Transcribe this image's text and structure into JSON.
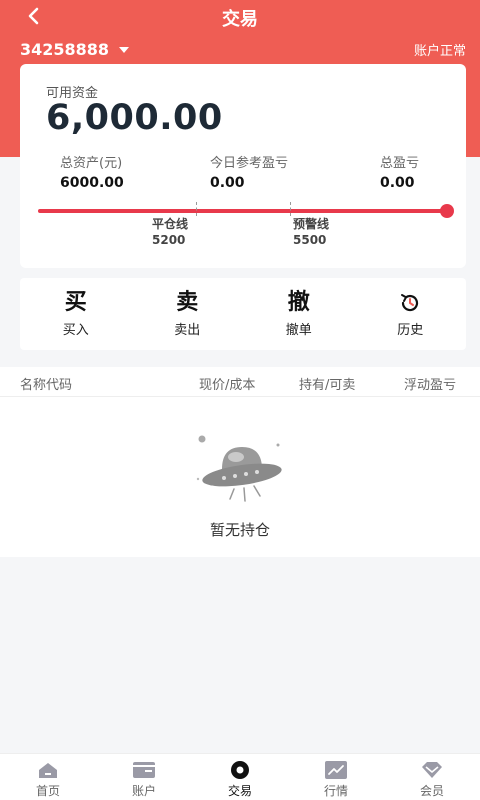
{
  "header": {
    "title": "交易",
    "back_icon": "chevron-left-icon",
    "account_number": "34258888",
    "account_status": "账户正常"
  },
  "funds": {
    "available_label": "可用资金",
    "available_value": "6,000.00",
    "stats": [
      {
        "label": "总资产(元)",
        "value": "6000.00"
      },
      {
        "label": "今日参考盈亏",
        "value": "0.00"
      },
      {
        "label": "总盈亏",
        "value": "0.00"
      }
    ],
    "markers": [
      {
        "label": "平仓线",
        "value": "5200"
      },
      {
        "label": "预警线",
        "value": "5500"
      }
    ]
  },
  "actions": [
    {
      "glyph": "买",
      "label": "买入"
    },
    {
      "glyph": "卖",
      "label": "卖出"
    },
    {
      "glyph": "撤",
      "label": "撤单"
    },
    {
      "icon": "history-icon",
      "label": "历史"
    }
  ],
  "table": {
    "headers": [
      "名称代码",
      "现价/成本",
      "持有/可卖",
      "浮动盈亏"
    ]
  },
  "empty": {
    "text": "暂无持仓",
    "icon": "ufo-icon"
  },
  "tabs": [
    {
      "label": "首页",
      "icon": "home-icon"
    },
    {
      "label": "账户",
      "icon": "wallet-icon"
    },
    {
      "label": "交易",
      "icon": "trade-icon",
      "active": true
    },
    {
      "label": "行情",
      "icon": "chart-icon"
    },
    {
      "label": "会员",
      "icon": "diamond-icon"
    }
  ],
  "colors": {
    "primary": "#ef5d54",
    "progress": "#e8394b",
    "background": "#f5f6f8"
  }
}
